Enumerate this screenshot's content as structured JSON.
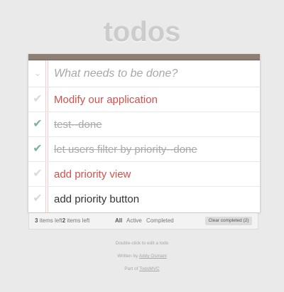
{
  "header": {
    "title": "todos"
  },
  "new_todo": {
    "placeholder": "What needs to be done?",
    "value": ""
  },
  "toggle_all": {
    "icon": "chevron-double-down-icon"
  },
  "todos": [
    {
      "label": "Modify our application",
      "completed": false
    },
    {
      "label": "test--done",
      "completed": true
    },
    {
      "label": "let users filter by priority--done",
      "completed": true
    },
    {
      "label": "add priority view",
      "completed": false
    },
    {
      "label": "add priority button",
      "completed": false
    }
  ],
  "footer": {
    "count_left_1": "3",
    "count_text_1": " items left",
    "count_left_2": "2",
    "count_text_2": " items left",
    "filters": [
      "All",
      "Active",
      "Completed"
    ],
    "selected_filter": "All",
    "clear_completed": "Clear completed (2)"
  },
  "info": {
    "line1": "Double-click to edit a todo",
    "line2_prefix": "Written by ",
    "line2_link": "Addy Osmani",
    "line3_prefix": "Part of ",
    "line3_link": "TodoMVC"
  },
  "colors": {
    "background": "#eaeaea",
    "header_bar": "#8e7f75",
    "todo_text_red": "#d1504b",
    "check_done": "#7fb2a2",
    "done_text": "#a9a9a9"
  }
}
